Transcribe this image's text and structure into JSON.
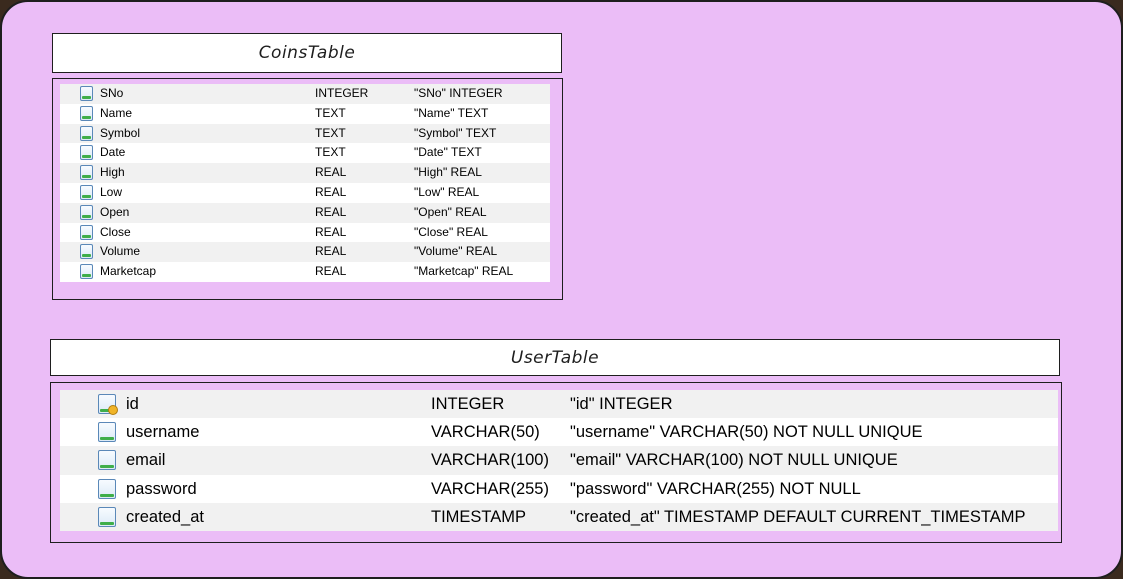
{
  "coins_table": {
    "title": "CoinsTable",
    "columns": [
      {
        "name": "SNo",
        "type": "INTEGER",
        "sql": "\"SNo\" INTEGER",
        "icon": "column-icon"
      },
      {
        "name": "Name",
        "type": "TEXT",
        "sql": "\"Name\" TEXT",
        "icon": "column-icon"
      },
      {
        "name": "Symbol",
        "type": "TEXT",
        "sql": "\"Symbol\" TEXT",
        "icon": "column-icon"
      },
      {
        "name": "Date",
        "type": "TEXT",
        "sql": "\"Date\" TEXT",
        "icon": "column-icon"
      },
      {
        "name": "High",
        "type": "REAL",
        "sql": "\"High\" REAL",
        "icon": "column-icon"
      },
      {
        "name": "Low",
        "type": "REAL",
        "sql": "\"Low\" REAL",
        "icon": "column-icon"
      },
      {
        "name": "Open",
        "type": "REAL",
        "sql": "\"Open\" REAL",
        "icon": "column-icon"
      },
      {
        "name": "Close",
        "type": "REAL",
        "sql": "\"Close\" REAL",
        "icon": "column-icon"
      },
      {
        "name": "Volume",
        "type": "REAL",
        "sql": "\"Volume\" REAL",
        "icon": "column-icon"
      },
      {
        "name": "Marketcap",
        "type": "REAL",
        "sql": "\"Marketcap\" REAL",
        "icon": "column-icon"
      }
    ]
  },
  "user_table": {
    "title": "UserTable",
    "columns": [
      {
        "name": "id",
        "type": "INTEGER",
        "sql": "\"id\" INTEGER",
        "icon": "primary-key-icon"
      },
      {
        "name": "username",
        "type": "VARCHAR(50)",
        "sql": "\"username\" VARCHAR(50) NOT NULL UNIQUE",
        "icon": "column-icon"
      },
      {
        "name": "email",
        "type": "VARCHAR(100)",
        "sql": "\"email\" VARCHAR(100) NOT NULL UNIQUE",
        "icon": "column-icon"
      },
      {
        "name": "password",
        "type": "VARCHAR(255)",
        "sql": "\"password\" VARCHAR(255) NOT NULL",
        "icon": "column-icon"
      },
      {
        "name": "created_at",
        "type": "TIMESTAMP",
        "sql": "\"created_at\" TIMESTAMP DEFAULT CURRENT_TIMESTAMP",
        "icon": "column-icon"
      }
    ]
  },
  "colors": {
    "canvas_background": "#ebbdf7",
    "title_background": "#ffffff",
    "stroke": "#1e1e1e",
    "row_alternate": "#f1f1f1"
  }
}
